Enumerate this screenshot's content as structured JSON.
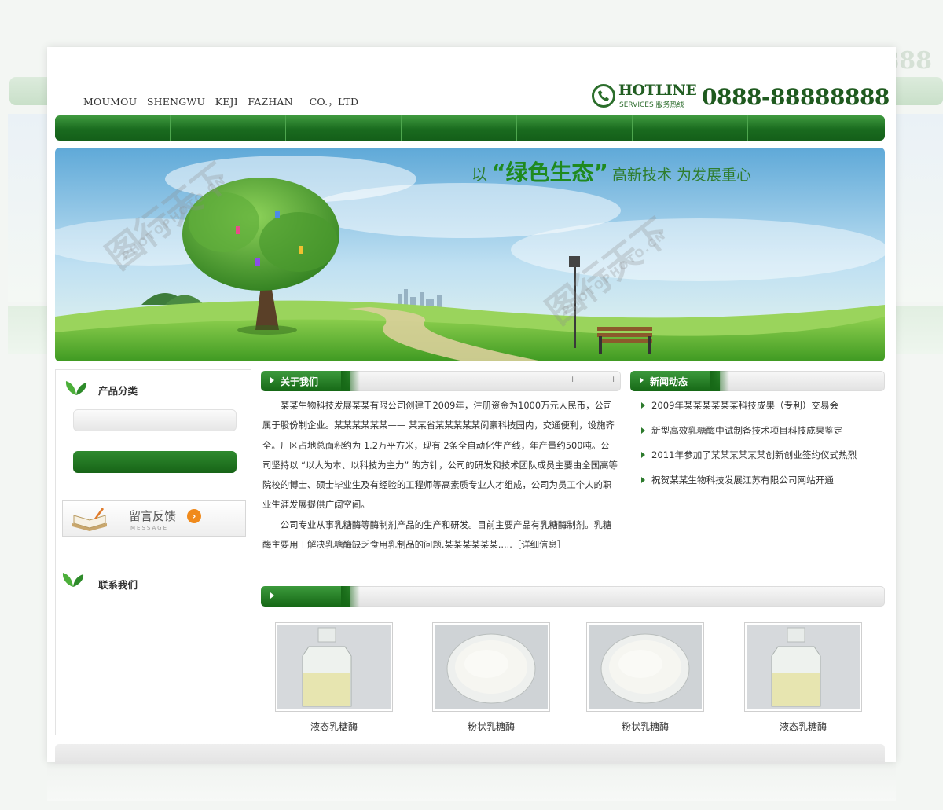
{
  "header": {
    "company_name": "MOUMOU   SHENGWU   KEJI   FAZHAN     CO.，LTD",
    "hotline_word": "HOTLINE",
    "hotline_sub": "SERVICES 服务热线",
    "phone": "0888-88888888"
  },
  "banner": {
    "slogan_prefix": "以",
    "slogan_highlight": "“绿色生态”",
    "slogan_suffix": "高新技术 为发展重心"
  },
  "watermark": {
    "cn": "图行天下",
    "en": "PHOTOPHOTO.CN"
  },
  "sidebar": {
    "category_title": "产品分类",
    "message": {
      "title": "留言反馈",
      "subtitle": "MESSAGE"
    },
    "contact_title": "联系我们"
  },
  "about": {
    "tab_label": "关于我们",
    "paragraph1": "某某生物科技发展某某有限公司创建于2009年，注册资金为1000万元人民币，公司属于股份制企业。某某某某某某—— 某某省某某某某某阆豪科技园内，交通便利，设施齐全。厂区占地总面积约为 1.2万平方米，现有 2条全自动化生产线，年产量约500吨。公司坚持以 “以人为本、以科技为主力” 的方针，公司的研发和技术团队成员主要由全国高等院校的博士、硕士毕业生及有经验的工程师等高素质专业人才组成，公司为员工个人的职业生涯发展提供广阔空间。",
    "paragraph2": "公司专业从事乳糖酶等酶制剂产品的生产和研发。目前主要产品有乳糖酶制剂。乳糖酶主要用于解决乳糖酶缺乏食用乳制品的问题.某某某某某某.....［详细信息］"
  },
  "news": {
    "tab_label": "新闻动态",
    "items": [
      "2009年某某某某某某科技成果（专利）交易会",
      "新型高效乳糖酶中试制备技术项目科技成果鉴定",
      "2011年参加了某某某某某某创新创业签约仪式热烈",
      "祝贺某某生物科技发展江苏有限公司网站开通"
    ]
  },
  "products": {
    "items": [
      {
        "name": "液态乳糖酶",
        "kind": "liquid"
      },
      {
        "name": "粉状乳糖酶",
        "kind": "powder"
      },
      {
        "name": "粉状乳糖酶",
        "kind": "powder"
      },
      {
        "name": "液态乳糖酶",
        "kind": "liquid"
      }
    ]
  },
  "colors": {
    "brand_green": "#1a6b1f",
    "accent_orange": "#f08a1c"
  }
}
